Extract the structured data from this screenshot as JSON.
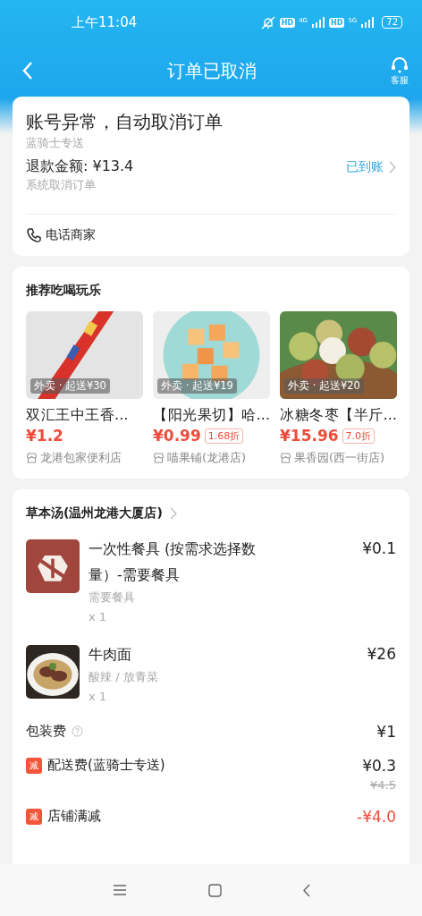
{
  "status_bar": {
    "time": "上午11:04",
    "networks": [
      {
        "hd": "HD",
        "type": "4G"
      },
      {
        "hd": "HD",
        "type": "5G"
      }
    ],
    "battery": "72"
  },
  "header": {
    "title": "订单已取消",
    "service_label": "客服"
  },
  "status_card": {
    "title": "账号异常，自动取消订单",
    "delivery": "蓝骑士专送",
    "refund": "退款金额: ¥13.4",
    "refund_status": "已到账",
    "reason": "系统取消订单",
    "call_label": "电话商家"
  },
  "recommendations": {
    "title": "推荐吃喝玩乐",
    "items": [
      {
        "tag": "外卖 · 起送¥30",
        "name": "双汇王中王香…",
        "price": "¥1.2",
        "shop": "龙港包家便利店"
      },
      {
        "tag": "外卖 · 起送¥19",
        "name": "【阳光果切】哈…",
        "price": "¥0.99",
        "discount": "1.68折",
        "shop": "喵果铺(龙港店)"
      },
      {
        "tag": "外卖 · 起送¥20",
        "name": "冰糖冬枣【半斤…",
        "price": "¥15.96",
        "discount": "7.0折",
        "shop": "果香园(西一街店)"
      }
    ]
  },
  "order": {
    "store": "草本汤(温州龙港大厦店)",
    "items": [
      {
        "name": "一次性餐具 (按需求选择数量）-需要餐具",
        "spec": "需要餐具",
        "qty": "x 1",
        "price": "¥0.1"
      },
      {
        "name": "牛肉面",
        "spec": "酸辣 / 放青菜",
        "qty": "x 1",
        "price": "¥26"
      }
    ],
    "fees": [
      {
        "kind": "fee",
        "label": "包装费",
        "amount": "¥1"
      },
      {
        "kind": "discounted",
        "badge": "减",
        "label": "配送费(蓝骑士专送)",
        "amount": "¥0.3",
        "original": "¥4.5"
      },
      {
        "kind": "reduction",
        "badge": "减",
        "label": "店铺满减",
        "amount": "-¥4.0"
      }
    ]
  }
}
